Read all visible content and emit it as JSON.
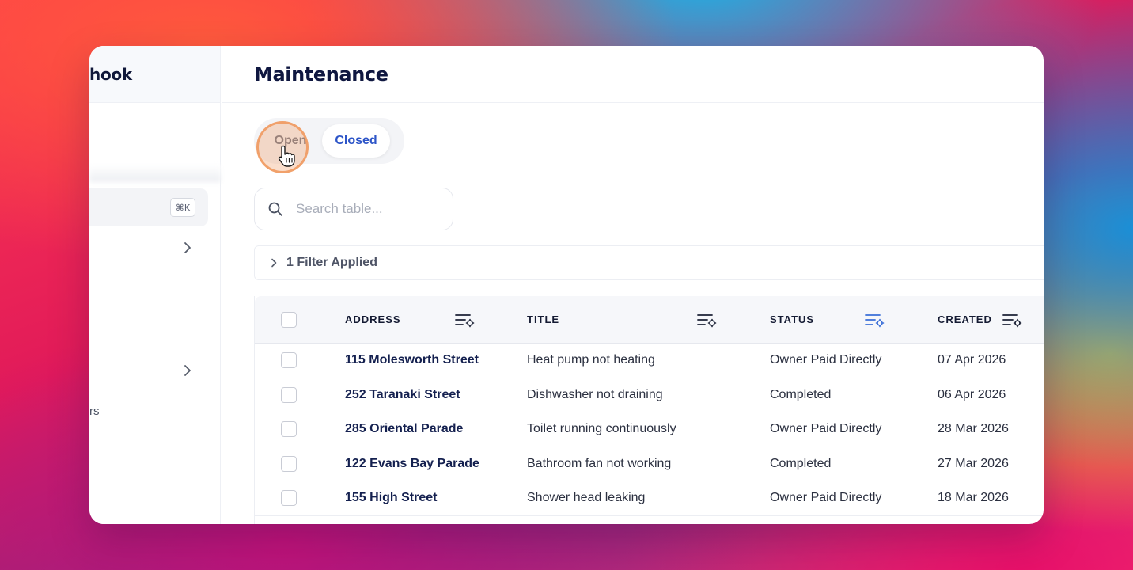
{
  "app": {
    "brand_partial": "hook",
    "page_title": "Maintenance"
  },
  "sidebar": {
    "shortcut": "⌘K",
    "partial_item": "rs"
  },
  "tabs": [
    {
      "label": "Open",
      "active": false
    },
    {
      "label": "Closed",
      "active": true
    }
  ],
  "search": {
    "placeholder": "Search table...",
    "value": ""
  },
  "filter": {
    "label": "1 Filter Applied"
  },
  "table": {
    "columns": [
      "ADDRESS",
      "TITLE",
      "STATUS",
      "CREATED"
    ],
    "rows": [
      {
        "address": "115 Molesworth Street",
        "title": "Heat pump not heating",
        "status": "Owner Paid Directly",
        "created": "07 Apr 2026"
      },
      {
        "address": "252 Taranaki Street",
        "title": "Dishwasher not draining",
        "status": "Completed",
        "created": "06 Apr 2026"
      },
      {
        "address": "285 Oriental Parade",
        "title": "Toilet running continuously",
        "status": "Owner Paid Directly",
        "created": "28 Mar 2026"
      },
      {
        "address": "122 Evans Bay Parade",
        "title": "Bathroom fan not working",
        "status": "Completed",
        "created": "27 Mar 2026"
      },
      {
        "address": "155 High Street",
        "title": "Shower head leaking",
        "status": "Owner Paid Directly",
        "created": "18 Mar 2026"
      }
    ]
  },
  "colors": {
    "accent": "#2d55c8",
    "title": "#0f1740",
    "status_filter_icon": "#3b6fd8"
  },
  "icons": [
    "search-icon",
    "chevron-right-icon",
    "column-settings-icon",
    "hand-pointer-icon"
  ]
}
